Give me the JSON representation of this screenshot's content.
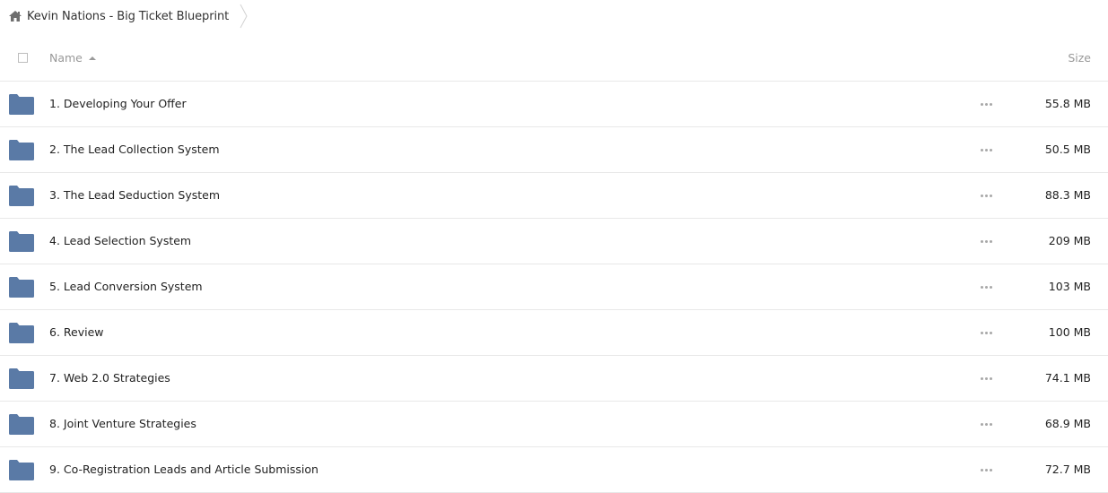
{
  "breadcrumb": {
    "home_icon": "home-icon",
    "title": "Kevin Nations - Big Ticket Blueprint",
    "separator_icon": "chevron-right-icon"
  },
  "header": {
    "name_label": "Name",
    "size_label": "Size",
    "sort_icon": "sort-ascending-icon"
  },
  "colors": {
    "folder": "#5a7aa6",
    "border": "#e8e8e8",
    "header_text": "#999999"
  },
  "files": [
    {
      "name": "1. Developing Your Offer",
      "size": "55.8 MB",
      "icon": "folder-icon"
    },
    {
      "name": "2. The Lead Collection System",
      "size": "50.5 MB",
      "icon": "folder-icon"
    },
    {
      "name": "3. The Lead Seduction System",
      "size": "88.3 MB",
      "icon": "folder-icon"
    },
    {
      "name": "4. Lead Selection System",
      "size": "209 MB",
      "icon": "folder-icon"
    },
    {
      "name": "5. Lead Conversion System",
      "size": "103 MB",
      "icon": "folder-icon"
    },
    {
      "name": "6. Review",
      "size": "100 MB",
      "icon": "folder-icon"
    },
    {
      "name": "7. Web 2.0 Strategies",
      "size": "74.1 MB",
      "icon": "folder-icon"
    },
    {
      "name": "8. Joint Venture Strategies",
      "size": "68.9 MB",
      "icon": "folder-icon"
    },
    {
      "name": "9. Co-Registration Leads and Article Submission",
      "size": "72.7 MB",
      "icon": "folder-icon"
    }
  ]
}
